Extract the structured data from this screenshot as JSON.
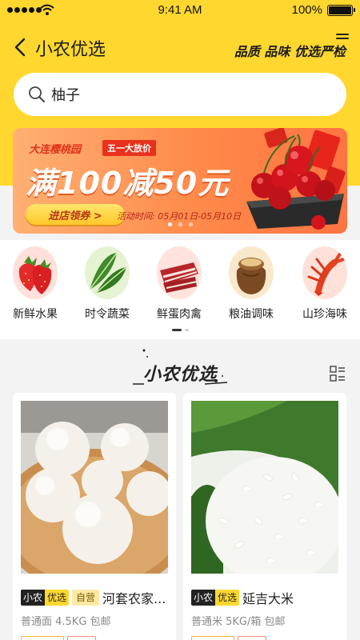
{
  "status_bar": {
    "time": "9:41 AM",
    "battery": "100%"
  },
  "nav": {
    "title": "小农优选",
    "slogan": "品质 品味 优选严检"
  },
  "search": {
    "value": "柚子"
  },
  "banner": {
    "shop": "大连樱桃园",
    "tag": "五一大放价",
    "headline": "满100减50元",
    "cta": "进店领券 >",
    "period": "活动时间: 05月01日-05月10日",
    "slides": 3,
    "active_slide": 1
  },
  "categories": [
    {
      "label": "新鲜水果",
      "icon": "strawberry-icon"
    },
    {
      "label": "时令蔬菜",
      "icon": "leafy-greens-icon"
    },
    {
      "label": "鲜蛋肉禽",
      "icon": "meat-icon"
    },
    {
      "label": "粮油调味",
      "icon": "grain-sack-icon"
    },
    {
      "label": "山珍海味",
      "icon": "lobster-icon"
    }
  ],
  "section": {
    "title": "小农优选"
  },
  "products": [
    {
      "badge_left": "小农",
      "badge_right": "优选",
      "self_tag": "自营",
      "name": "河套农家...",
      "spec": "普通面 4.5KG 包邮",
      "image": "steamed-buns-photo"
    },
    {
      "badge_left": "小农",
      "badge_right": "优选",
      "name": "延吉大米",
      "spec": "普通米 5KG/箱 包邮",
      "image": "rice-photo"
    }
  ],
  "colors": {
    "brand_yellow": "#ffd72e",
    "banner_orange": "#ff8a4a",
    "text_dark": "#222222"
  }
}
